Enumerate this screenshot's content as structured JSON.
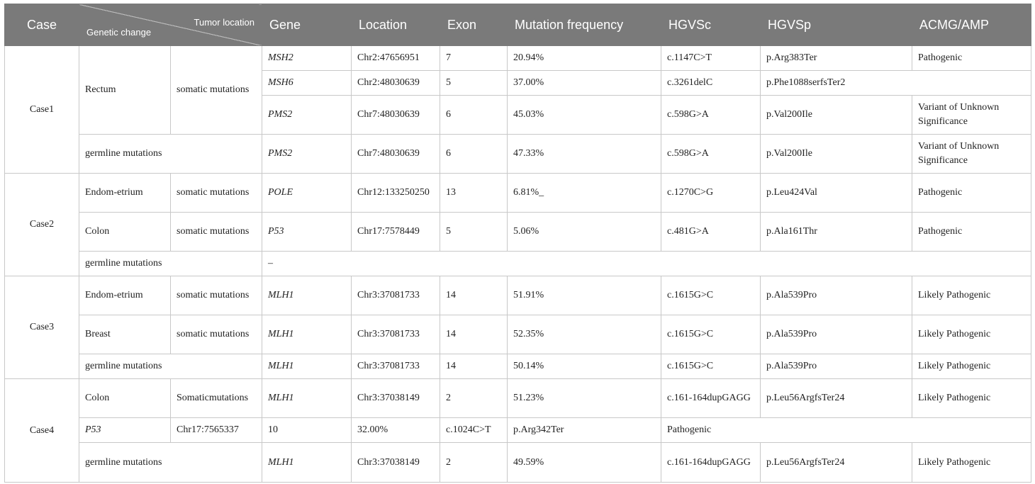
{
  "table": {
    "headers": {
      "case": "Case",
      "genetic_change": "Genetic change",
      "tumor_location": "Tumor location",
      "gene": "Gene",
      "location": "Location",
      "exon": "Exon",
      "mutation_frequency": "Mutation frequency",
      "hgvsc": "HGVSc",
      "hgvsp": "HGVSp",
      "acmg_amp": "ACMG/AMP"
    },
    "rows": [
      {
        "case": "Case1",
        "tumor": "Rectum",
        "change": "somatic mutations",
        "gene": "MSH2",
        "location": "Chr2:47656951",
        "exon": "7",
        "freq": "20.94%",
        "hgvsc": "c.1147C>T",
        "hgvsp": "p.Arg383Ter",
        "acmg": "Pathogenic"
      },
      {
        "gene": "MSH6",
        "location": "Chr2:48030639",
        "exon": "5",
        "freq": "37.00%",
        "hgvsc": "c.3261delC",
        "hgvsp": "p.Phe1088serfsTer2"
      },
      {
        "gene": "PMS2",
        "location": "Chr7:48030639",
        "exon": "6",
        "freq": "45.03%",
        "hgvsc": "c.598G>A",
        "hgvsp": "p.Val200Ile",
        "acmg": "Variant of Unknown Significance"
      },
      {
        "change": "germline mutations",
        "gene": "PMS2",
        "location": "Chr7:48030639",
        "exon": "6",
        "freq": "47.33%",
        "hgvsc": "c.598G>A",
        "hgvsp": "p.Val200Ile",
        "acmg": "Variant of Unknown Significance"
      },
      {
        "case": "Case2",
        "tumor": "Endom-etrium",
        "change": "somatic mutations",
        "gene": "POLE",
        "location": "Chr12:133250250",
        "exon": "13",
        "freq": "6.81%_",
        "hgvsc": "c.1270C>G",
        "hgvsp": "p.Leu424Val",
        "acmg": "Pathogenic"
      },
      {
        "tumor": "Colon",
        "change": "somatic mutations",
        "gene": "P53",
        "location": "Chr17:7578449",
        "exon": "5",
        "freq": "5.06%",
        "hgvsc": "c.481G>A",
        "hgvsp": "p.Ala161Thr",
        "acmg": "Pathogenic"
      },
      {
        "change": "germline mutations",
        "gene": "–"
      },
      {
        "case": "Case3",
        "tumor": "Endom-etrium",
        "change": "somatic mutations",
        "gene": "MLH1",
        "location": "Chr3:37081733",
        "exon": "14",
        "freq": "51.91%",
        "hgvsc": "c.1615G>C",
        "hgvsp": "p.Ala539Pro",
        "acmg": "Likely Pathogenic"
      },
      {
        "tumor": "Breast",
        "change": "somatic mutations",
        "gene": "MLH1",
        "location": "Chr3:37081733",
        "exon": "14",
        "freq": "52.35%",
        "hgvsc": "c.1615G>C",
        "hgvsp": "p.Ala539Pro",
        "acmg": "Likely Pathogenic"
      },
      {
        "change": "germline mutations",
        "gene": "MLH1",
        "location": "Chr3:37081733",
        "exon": "14",
        "freq": "50.14%",
        "hgvsc": "c.1615G>C",
        "hgvsp": "p.Ala539Pro",
        "acmg": "Likely Pathogenic"
      },
      {
        "case": "Case4",
        "tumor": "Colon",
        "change": "Somaticmutations",
        "gene": "MLH1",
        "location": "Chr3:37038149",
        "exon": "2",
        "freq": "51.23%",
        "hgvsc": "c.161-164dupGAGG",
        "hgvsp": "p.Leu56ArgfsTer24",
        "acmg": "Likely Pathogenic"
      },
      {
        "c1": "P53",
        "c2": "Chr17:7565337",
        "c3": "10",
        "c4": "32.00%",
        "c5": "c.1024C>T",
        "c6": "p.Arg342Ter",
        "c7": "Pathogenic"
      },
      {
        "change": "germline mutations",
        "gene": "MLH1",
        "location": "Chr3:37038149",
        "exon": "2",
        "freq": "49.59%",
        "hgvsc": "c.161-164dupGAGG",
        "hgvsp": "p.Leu56ArgfsTer24",
        "acmg": "Likely Pathogenic"
      }
    ]
  }
}
